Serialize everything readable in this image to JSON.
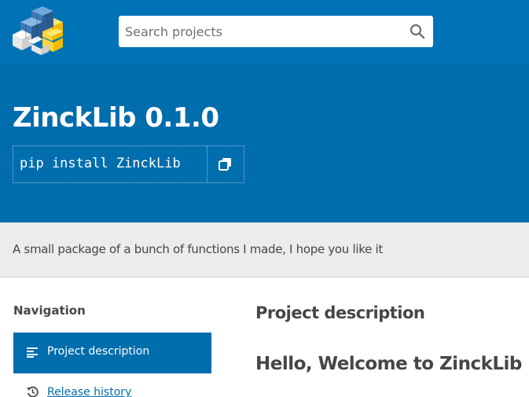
{
  "header": {
    "logo_icon": "pypi-cubes-logo",
    "search": {
      "placeholder": "Search projects",
      "value": "",
      "icon": "search-icon"
    }
  },
  "banner": {
    "title": "ZinckLib 0.1.0",
    "pip_command": "pip install ZinckLib",
    "copy_icon": "copy-icon"
  },
  "summary": "A small package of a bunch of functions I made, I hope you like it",
  "navigation": {
    "heading": "Navigation",
    "items": [
      {
        "label": "Project description",
        "icon": "align-left-icon",
        "active": true
      },
      {
        "label": "Release history",
        "icon": "history-icon",
        "active": false
      }
    ]
  },
  "main": {
    "section_heading": "Project description",
    "readme_heading": "Hello, Welcome to ZinckLib"
  },
  "colors": {
    "header_blue": "#0073b7",
    "banner_blue": "#006dad",
    "summary_gray": "#ececec",
    "text": "#464646"
  }
}
